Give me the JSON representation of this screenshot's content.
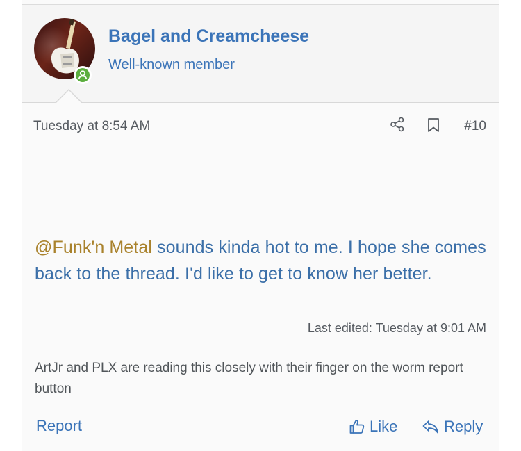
{
  "user": {
    "name": "Bagel and Creamcheese",
    "title": "Well-known member",
    "avatar_icon": "guitar-avatar",
    "online_icon": "user-online-icon"
  },
  "post": {
    "timestamp": "Tuesday at 8:54 AM",
    "number": "#10",
    "mention": "@Funk'n Metal",
    "body": " sounds kinda hot to me. I hope she comes back to the thread. I'd like to get to know her better.",
    "last_edited": "Last edited: Tuesday at 9:01 AM"
  },
  "signature": {
    "before": "ArtJr and PLX are reading this closely with their finger on the ",
    "struck": "worm",
    "after": " report button"
  },
  "actions": {
    "report": "Report",
    "like": "Like",
    "reply": "Reply",
    "share_icon": "share-icon",
    "bookmark_icon": "bookmark-icon"
  },
  "colors": {
    "link": "#3b74b8",
    "mention": "#a9822c",
    "online": "#5cae3f",
    "header_bg": "#f5f5f5"
  }
}
